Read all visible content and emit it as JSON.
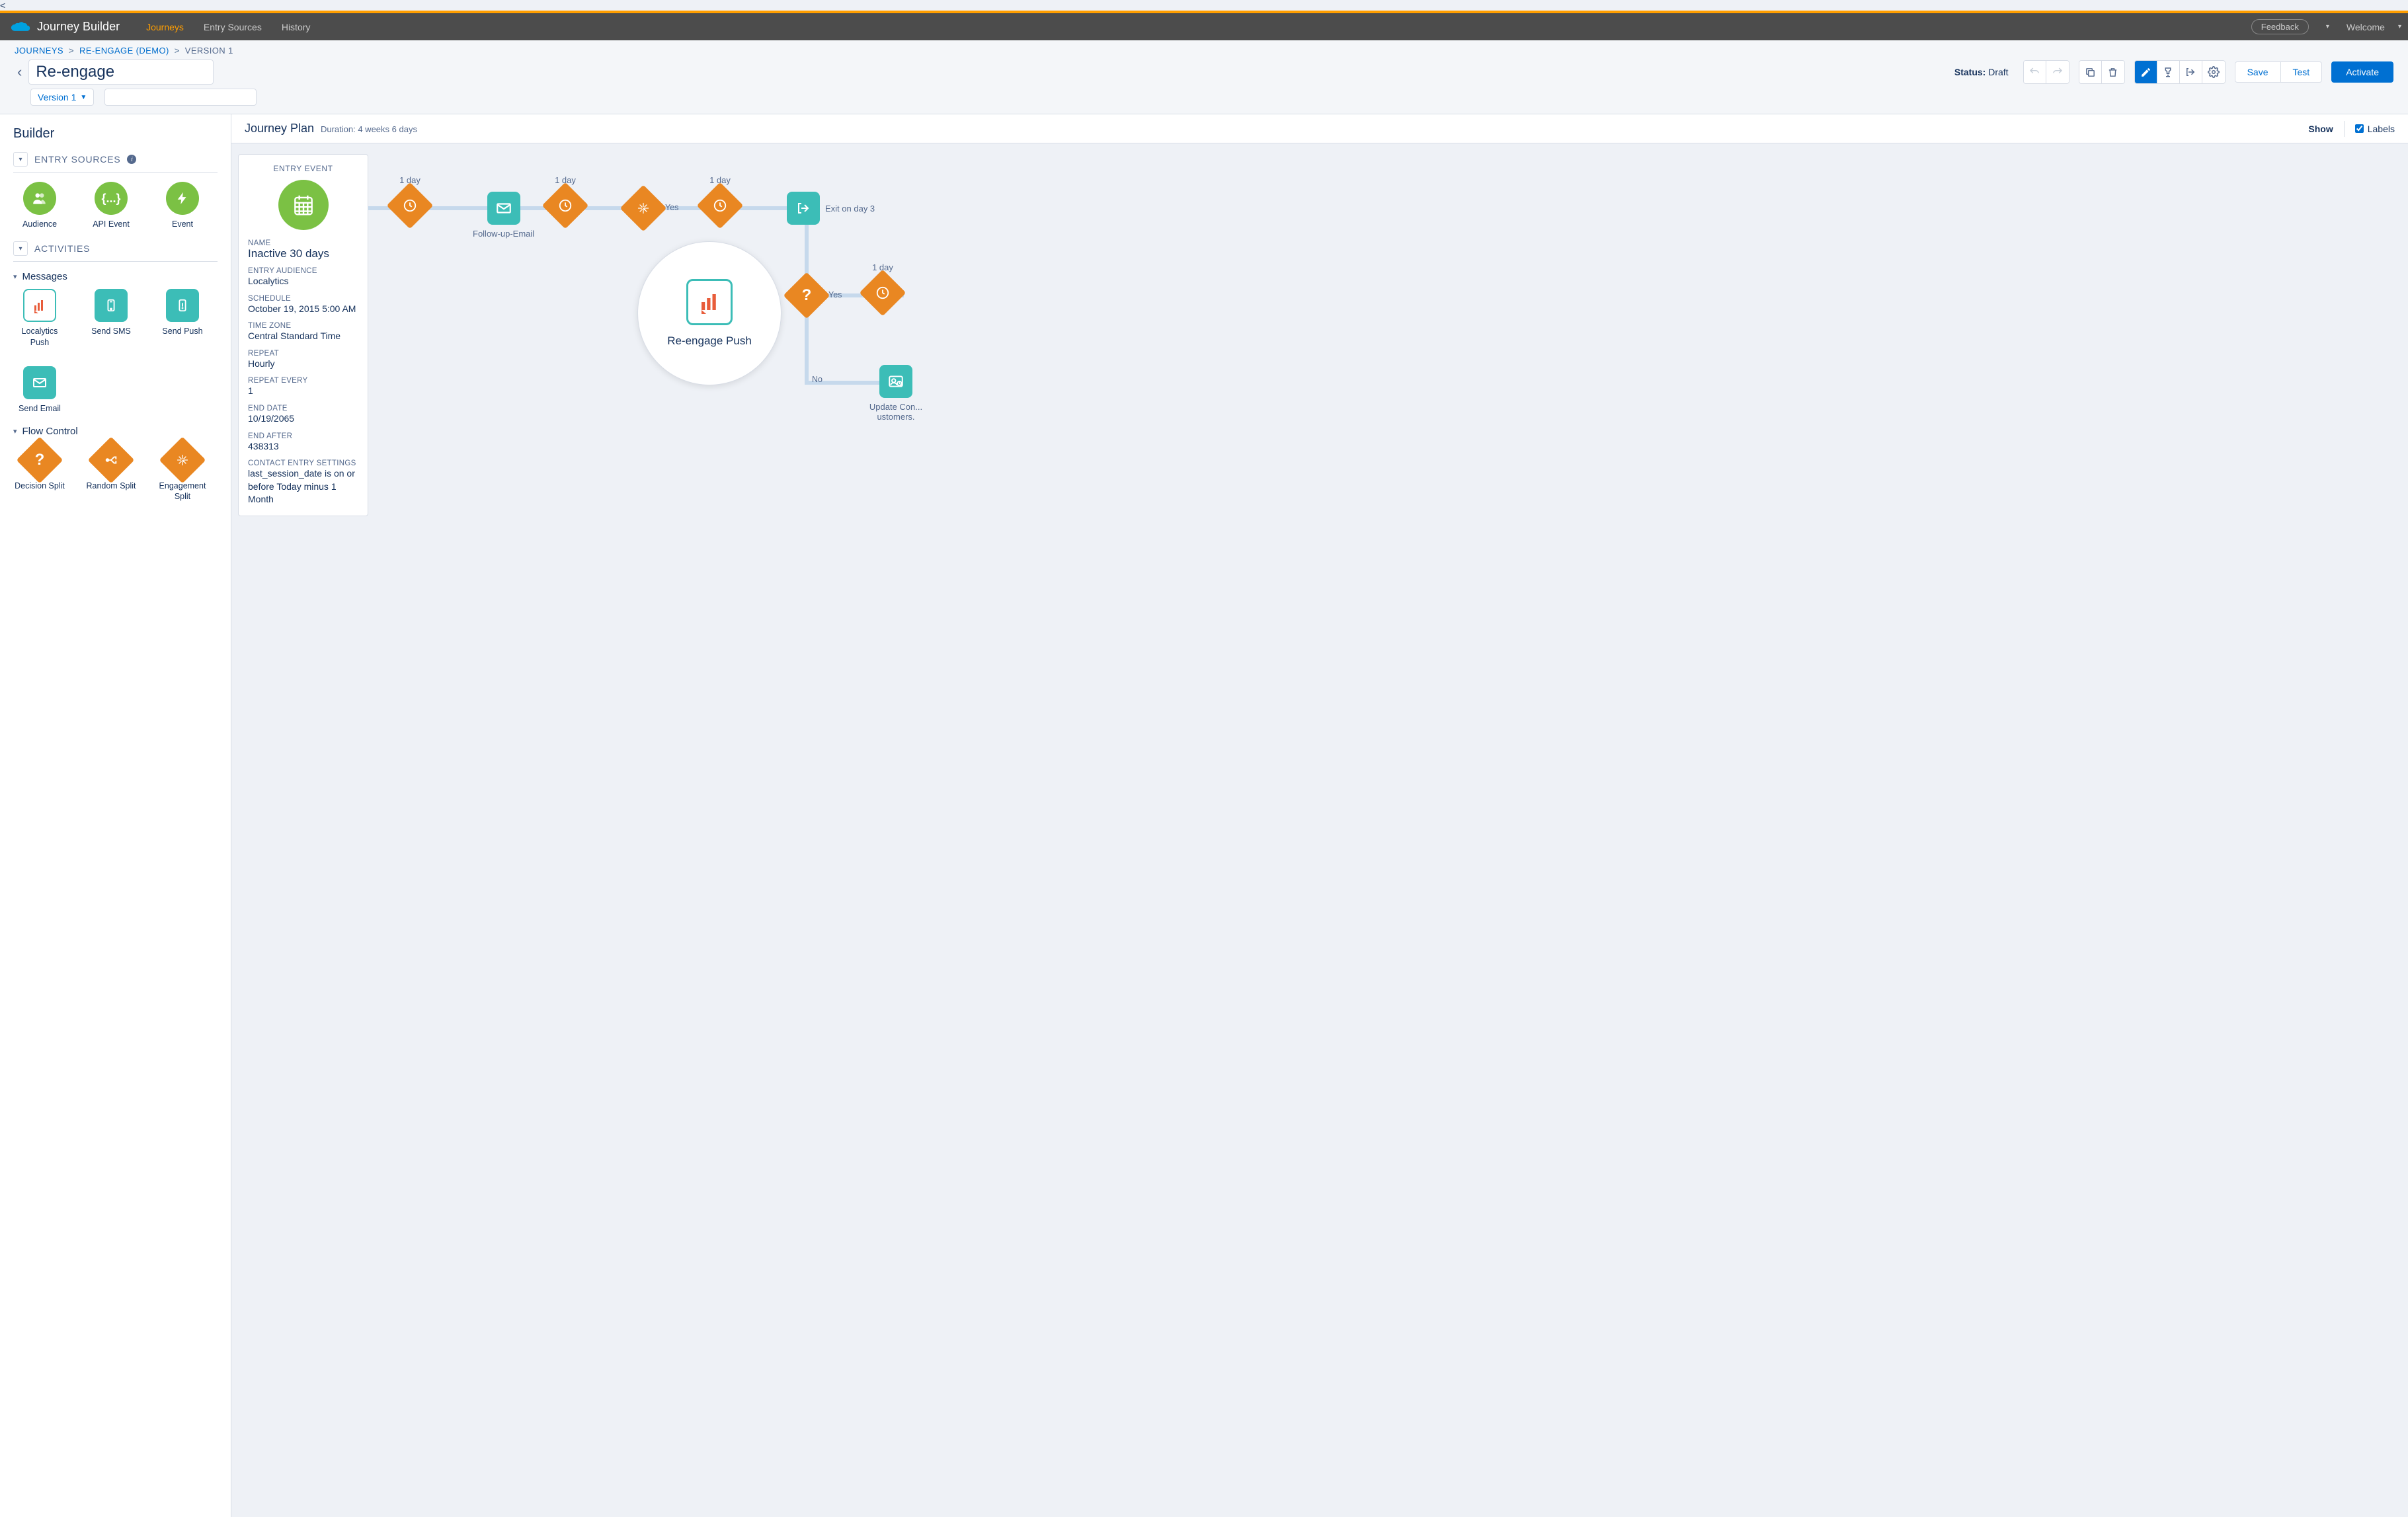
{
  "topbar": {
    "app_title": "Journey Builder",
    "nav": [
      "Journeys",
      "Entry Sources",
      "History"
    ],
    "active_nav": "Journeys",
    "feedback": "Feedback",
    "welcome": "Welcome"
  },
  "breadcrumb": {
    "items": [
      "JOURNEYS",
      "RE-ENGAGE (DEMO)"
    ],
    "current": "VERSION 1"
  },
  "header": {
    "title": "Re-engage",
    "version": "Version 1",
    "status_label": "Status:",
    "status_value": "Draft",
    "save": "Save",
    "test": "Test",
    "activate": "Activate"
  },
  "sidebar": {
    "title": "Builder",
    "entry_sources_label": "ENTRY SOURCES",
    "activities_label": "ACTIVITIES",
    "entry_sources": [
      {
        "label": "Audience",
        "icon": "audience"
      },
      {
        "label": "API Event",
        "icon": "api"
      },
      {
        "label": "Event",
        "icon": "event"
      }
    ],
    "messages_label": "Messages",
    "messages": [
      {
        "label": "Localytics Push",
        "icon": "localytics",
        "selected": true
      },
      {
        "label": "Send SMS",
        "icon": "sms"
      },
      {
        "label": "Send Push",
        "icon": "push"
      },
      {
        "label": "Send Email",
        "icon": "email"
      }
    ],
    "flow_label": "Flow Control",
    "flow": [
      {
        "label": "Decision Split",
        "icon": "decision"
      },
      {
        "label": "Random Split",
        "icon": "random"
      },
      {
        "label": "Engagement Split",
        "icon": "engagement"
      }
    ]
  },
  "canvas_header": {
    "title": "Journey Plan",
    "duration_label": "Duration:",
    "duration": "4 weeks 6 days",
    "show": "Show",
    "labels": "Labels"
  },
  "entry": {
    "header": "ENTRY EVENT",
    "name_label": "NAME",
    "name": "Inactive 30 days",
    "audience_label": "ENTRY AUDIENCE",
    "audience": "Localytics",
    "schedule_label": "SCHEDULE",
    "schedule": "October 19, 2015 5:00 AM",
    "tz_label": "TIME ZONE",
    "tz": "Central Standard Time",
    "repeat_label": "REPEAT",
    "repeat": "Hourly",
    "repeat_every_label": "REPEAT EVERY",
    "repeat_every": "1",
    "end_date_label": "END DATE",
    "end_date": "10/19/2065",
    "end_after_label": "END AFTER",
    "end_after": "438313",
    "contact_label": "CONTACT ENTRY SETTINGS",
    "contact": "last_session_date is on or before Today minus 1 Month"
  },
  "canvas": {
    "day_label": "1 day",
    "followup": "Follow-up-Email",
    "yes": "Yes",
    "no": "No",
    "exit": "Exit on day 3",
    "reengage": "Re-engage Push",
    "update": "Update Con... ustomers."
  }
}
